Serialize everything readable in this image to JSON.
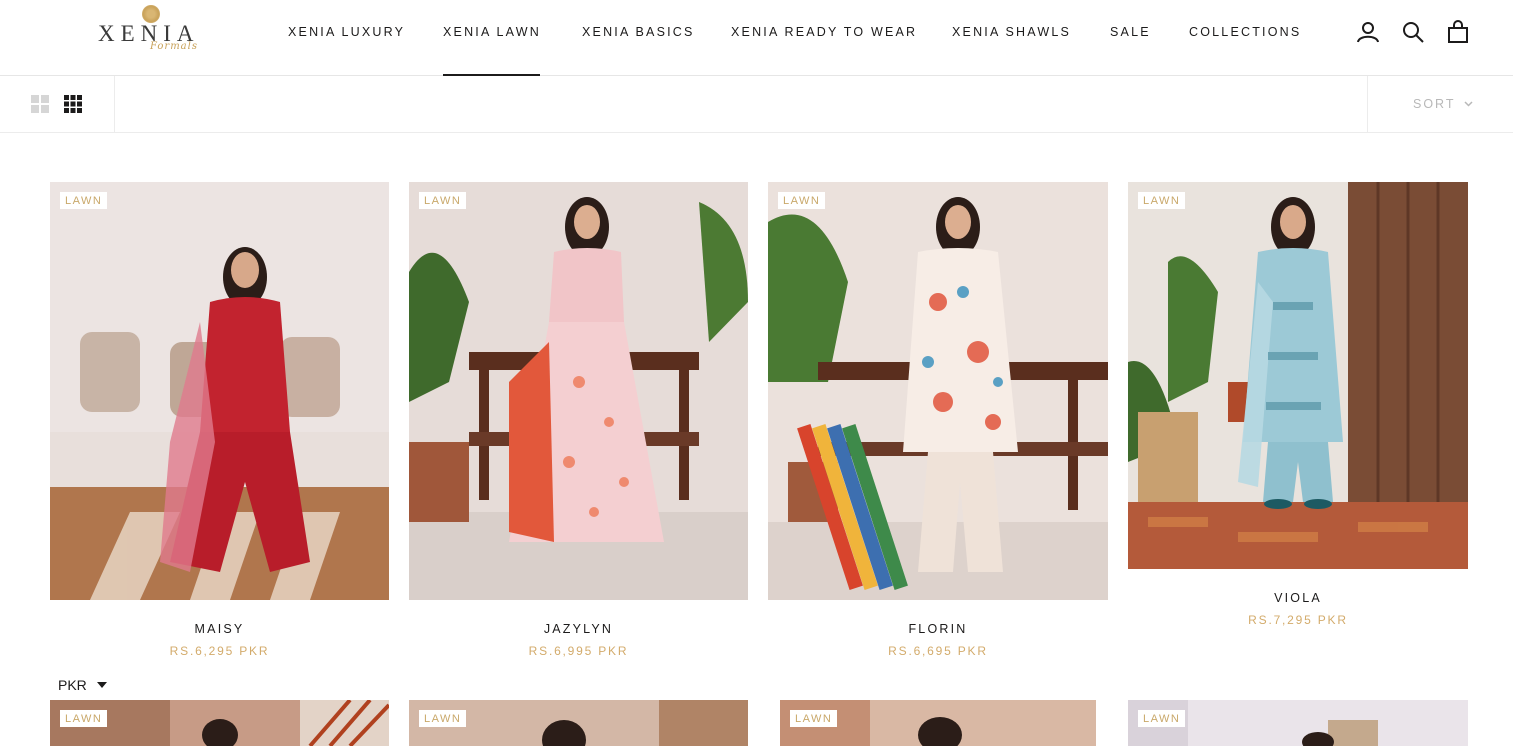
{
  "brand": {
    "name": "XENIA",
    "tagline": "Formals"
  },
  "nav": {
    "items": [
      {
        "label": "XENIA LUXURY"
      },
      {
        "label": "XENIA LAWN"
      },
      {
        "label": "XENIA BASICS"
      },
      {
        "label": "XENIA READY TO WEAR"
      },
      {
        "label": "XENIA SHAWLS"
      },
      {
        "label": "SALE"
      },
      {
        "label": "COLLECTIONS"
      }
    ],
    "active": "XENIA LAWN"
  },
  "header_icons": [
    "account-icon",
    "search-icon",
    "cart-icon"
  ],
  "toolbar": {
    "view_icons": [
      "grid-2-icon",
      "grid-3-icon"
    ],
    "sort_label": "SORT"
  },
  "products": [
    {
      "badge": "LAWN",
      "name": "MAISY",
      "price": "RS.6,295 PKR",
      "palette": "red"
    },
    {
      "badge": "LAWN",
      "name": "JAZYLYN",
      "price": "RS.6,995 PKR",
      "palette": "pink"
    },
    {
      "badge": "LAWN",
      "name": "FLORIN",
      "price": "RS.6,695 PKR",
      "palette": "floral"
    },
    {
      "badge": "LAWN",
      "name": "VIOLA",
      "price": "RS.7,295 PKR",
      "palette": "blue"
    }
  ],
  "second_row": [
    {
      "badge": "LAWN"
    },
    {
      "badge": "LAWN"
    },
    {
      "badge": "LAWN"
    },
    {
      "badge": "LAWN"
    }
  ],
  "currency": {
    "selected": "PKR"
  },
  "colors": {
    "accent_gold": "#d3ab6b",
    "text": "#1c1b1b",
    "badge_text": "#c9a86a"
  }
}
